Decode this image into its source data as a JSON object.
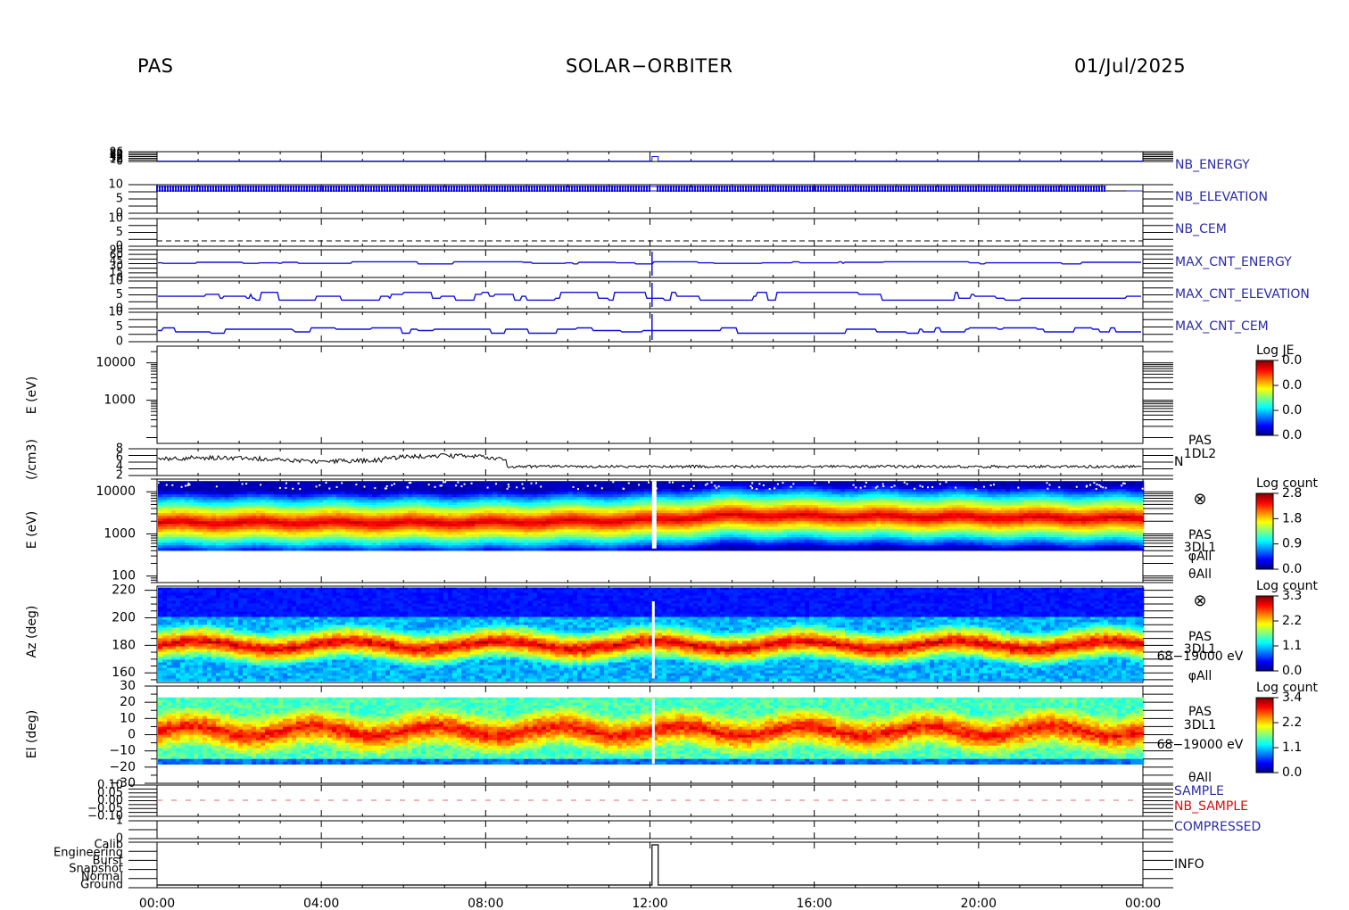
{
  "header": {
    "instrument": "PAS",
    "mission": "SOLAR−ORBITER",
    "date": "01/Jul/2025"
  },
  "chart_data": {
    "type": "multi-panel time series / spectrogram",
    "x_ticks": [
      "00:00",
      "04:00",
      "08:00",
      "12:00",
      "16:00",
      "20:00",
      "00:00"
    ],
    "x_range_hours": [
      0,
      24
    ],
    "panels": [
      {
        "name": "NB_ENERGY",
        "type": "line",
        "tick_labels": [
          "96",
          "80",
          "64",
          "48",
          "32",
          "16",
          "0"
        ],
        "series": [
          {
            "x": [
              0,
              12.05,
              12.05,
              12.2,
              12.2,
              24
            ],
            "y": [
              0,
              0,
              1,
              1,
              0,
              0
            ]
          }
        ]
      },
      {
        "name": "NB_ELEVATION",
        "type": "line",
        "tick_labels": [
          "10",
          "5",
          "0"
        ],
        "note": "dense binary oscillation between 8 and 10 across the day, ending near 23:10"
      },
      {
        "name": "NB_CEM",
        "type": "line",
        "tick_labels": [
          "10",
          "5",
          "0"
        ],
        "dashed_level": 2
      },
      {
        "name": "MAX_CNT_ENERGY",
        "type": "line",
        "tick_labels": [
          "90",
          "60",
          "45",
          "30",
          "15",
          "0"
        ],
        "level_fraction": 0.47
      },
      {
        "name": "MAX_CNT_ELEVATION",
        "type": "line",
        "tick_labels": [
          "10",
          "5",
          "0"
        ],
        "level_fraction": 0.55
      },
      {
        "name": "MAX_CNT_CEM",
        "type": "line",
        "tick_labels": [
          "10",
          "5",
          "0"
        ],
        "level_fraction": 0.3
      },
      {
        "name": "E (eV)",
        "type": "spectrogram",
        "yscale": "log",
        "yticks": [
          1000,
          10000
        ],
        "colorbar": {
          "title": "Log JE",
          "ticks": [
            "0.0",
            "0.0",
            "0.0",
            "0.0"
          ]
        }
      },
      {
        "name": "(/cm3)",
        "type": "line",
        "label": "N",
        "side_labels": [
          "PAS",
          "1DL2"
        ],
        "tick_labels": [
          "8",
          "6",
          "4",
          "2"
        ],
        "note": "density ~6 until 08:30 then ~4"
      },
      {
        "name": "E (eV)",
        "type": "spectrogram",
        "yscale": "log",
        "yticks": [
          100,
          1000,
          10000
        ],
        "ylim": [
          70,
          20000
        ],
        "side_labels": [
          "PAS",
          "3DL1",
          "φAll",
          "θAll"
        ],
        "colorbar": {
          "title": "Log count",
          "ticks": [
            "2.8",
            "1.8",
            "0.9",
            "0.0"
          ]
        },
        "peak_energy_eV": [
          {
            "hour": 0,
            "value": 2000
          },
          {
            "hour": 8,
            "value": 2000
          },
          {
            "hour": 12,
            "value": 2300
          },
          {
            "hour": 14,
            "value": 3000
          },
          {
            "hour": 24,
            "value": 2500
          }
        ]
      },
      {
        "name": "Az (deg)",
        "type": "spectrogram",
        "ylim": [
          153,
          223
        ],
        "yticks": [
          160,
          180,
          200,
          220
        ],
        "side_labels": [
          "PAS",
          "3DL1",
          "68−19000 eV",
          "φAll"
        ],
        "colorbar": {
          "title": "Log count",
          "ticks": [
            "3.3",
            "2.2",
            "1.1",
            "0.0"
          ]
        }
      },
      {
        "name": "El (deg)",
        "type": "spectrogram",
        "ylim": [
          -30,
          30
        ],
        "yticks": [
          -30,
          -20,
          -10,
          0,
          10,
          20,
          30
        ],
        "side_labels": [
          "PAS",
          "3DL1",
          "68−19000 eV",
          "θAll"
        ],
        "colorbar": {
          "title": "Log count",
          "ticks": [
            "3.4",
            "2.2",
            "1.1",
            "0.0"
          ]
        }
      },
      {
        "name": "SAMPLE / NB_SAMPLE",
        "type": "line",
        "labels": [
          "SAMPLE",
          "NB_SAMPLE"
        ],
        "tick_labels": [
          "0.10",
          "0.05",
          "0.00",
          "−0.05",
          "−0.10"
        ],
        "dashed_level": 0
      },
      {
        "name": "COMPRESSED",
        "type": "line",
        "tick_labels": [
          "1",
          "0"
        ]
      },
      {
        "name": "INFO",
        "type": "line",
        "tick_labels": [
          "Calib",
          "Engineering",
          "Burst",
          "Snapshot",
          "Normal",
          "Ground"
        ],
        "series": [
          {
            "x": [
              0,
              12.05,
              12.05,
              12.2,
              12.2,
              24
            ],
            "y": [
              "Ground",
              "Ground",
              "Calib",
              "Calib",
              "Ground",
              "Ground"
            ]
          }
        ]
      }
    ]
  },
  "colors": {
    "line_blue": "#1010d8",
    "label_blue": "#2a2aa6",
    "label_red": "#cc1010"
  },
  "cross_symbol": "⊗"
}
